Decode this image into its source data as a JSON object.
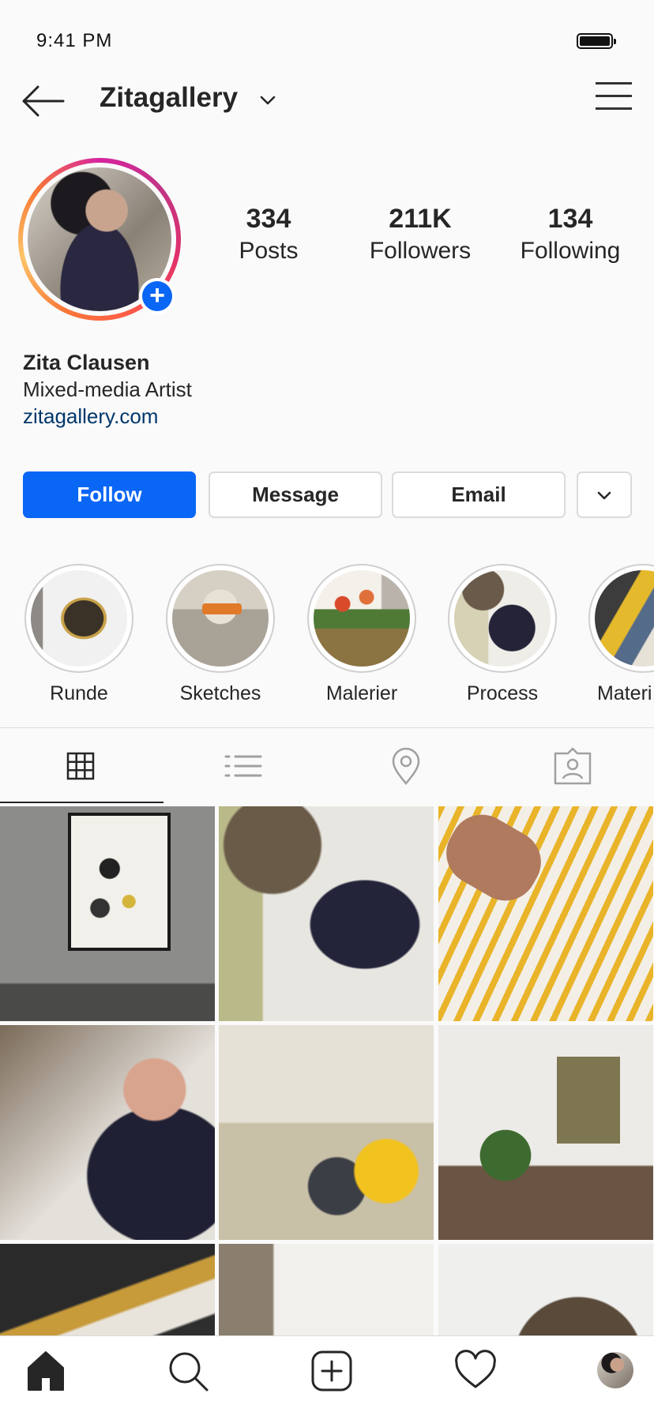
{
  "status_bar": {
    "time": "9:41 PM"
  },
  "header": {
    "username": "Zitagallery"
  },
  "profile": {
    "stats": [
      {
        "value": "334",
        "label": "Posts"
      },
      {
        "value": "211K",
        "label": "Followers"
      },
      {
        "value": "134",
        "label": "Following"
      }
    ],
    "name": "Zita Clausen",
    "description": "Mixed-media Artist",
    "link": "zitagallery.com"
  },
  "actions": {
    "follow": "Follow",
    "message": "Message",
    "email": "Email"
  },
  "highlights": [
    {
      "label": "Runde"
    },
    {
      "label": "Sketches"
    },
    {
      "label": "Malerier"
    },
    {
      "label": "Process"
    },
    {
      "label": "Materi"
    }
  ],
  "colors": {
    "accent": "#0a66f5",
    "link": "#00376b",
    "text": "#262626",
    "border": "#dbdbdb"
  },
  "icons": [
    "back-arrow-icon",
    "chevron-down-icon",
    "hamburger-menu-icon",
    "plus-icon",
    "grid-icon",
    "list-icon",
    "location-pin-icon",
    "tagged-person-icon",
    "home-icon",
    "search-icon",
    "add-post-icon",
    "heart-icon"
  ]
}
